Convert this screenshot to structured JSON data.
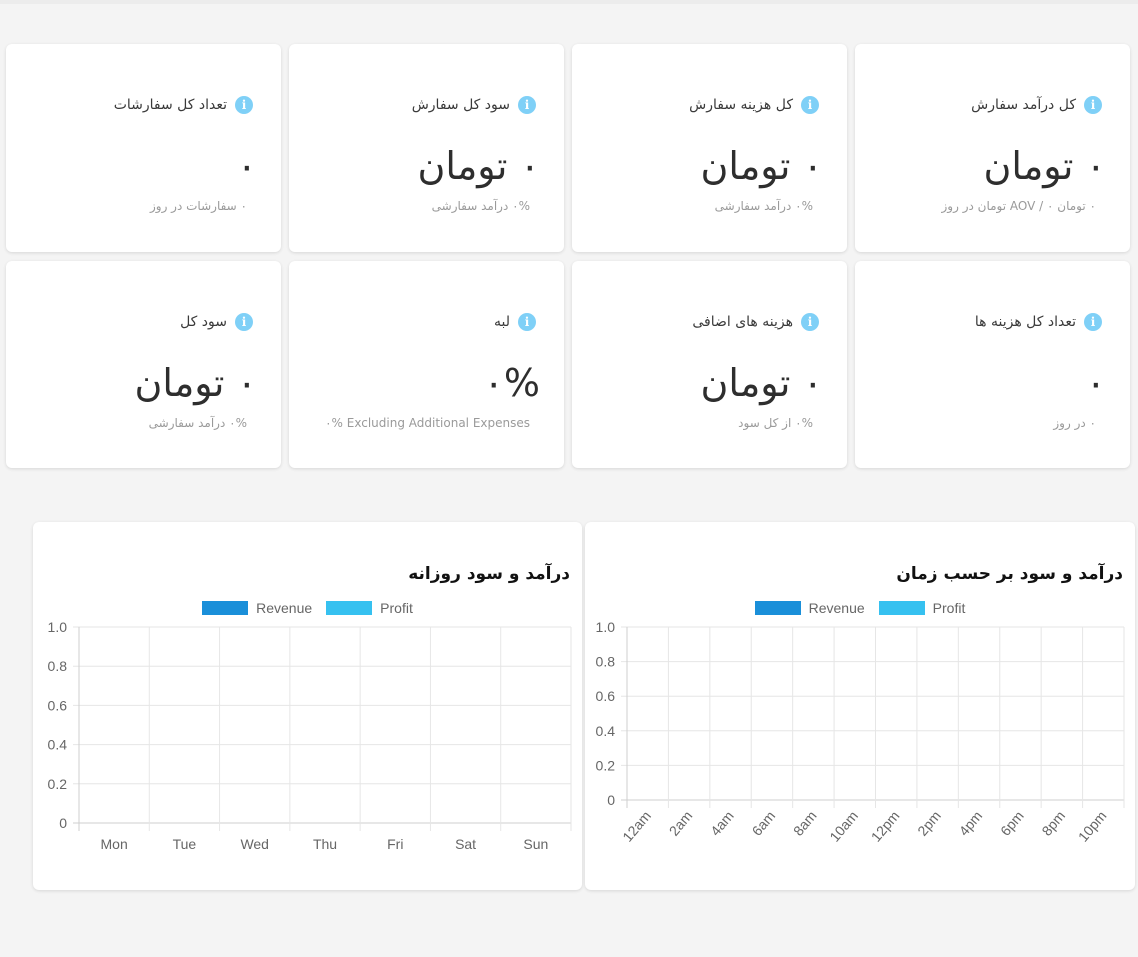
{
  "colors": {
    "revenue": "#1a8fd9",
    "profit": "#36c1f0",
    "info": "#7fd0f7"
  },
  "cards": [
    {
      "title": "کل درآمد سفارش",
      "value": "۰ تومان",
      "sub": "۰ تومان AOV / ۰ تومان در روز"
    },
    {
      "title": "کل هزینه سفارش",
      "value": "۰ تومان",
      "sub": "۰% درآمد سفارشی"
    },
    {
      "title": "سود کل سفارش",
      "value": "۰ تومان",
      "sub": "۰% درآمد سفارشی"
    },
    {
      "title": "تعداد کل سفارشات",
      "value": "۰",
      "sub": "۰ سفارشات در روز"
    },
    {
      "title": "تعداد کل هزینه ها",
      "value": "۰",
      "sub": "۰ در روز"
    },
    {
      "title": "هزینه های اضافی",
      "value": "۰ تومان",
      "sub": "۰% از کل سود"
    },
    {
      "title": "لبه",
      "value": "۰%",
      "sub": "۰% Excluding Additional Expenses"
    },
    {
      "title": "سود کل",
      "value": "۰ تومان",
      "sub": "۰% درآمد سفارشی"
    }
  ],
  "chart_data": [
    {
      "type": "bar",
      "title": "درآمد و سود بر حسب زمان",
      "categories": [
        "12am",
        "2am",
        "4am",
        "6am",
        "8am",
        "10am",
        "12pm",
        "2pm",
        "4pm",
        "6pm",
        "8pm",
        "10pm"
      ],
      "series": [
        {
          "name": "Revenue",
          "values": [
            0,
            0,
            0,
            0,
            0,
            0,
            0,
            0,
            0,
            0,
            0,
            0
          ]
        },
        {
          "name": "Profit",
          "values": [
            0,
            0,
            0,
            0,
            0,
            0,
            0,
            0,
            0,
            0,
            0,
            0
          ]
        }
      ],
      "ylim": [
        0,
        1.0
      ],
      "yticks": [
        "1.0",
        "0.8",
        "0.6",
        "0.4",
        "0.2",
        "0"
      ],
      "legend": "top-center",
      "grid": true
    },
    {
      "type": "bar",
      "title": "درآمد و سود روزانه",
      "categories": [
        "Mon",
        "Tue",
        "Wed",
        "Thu",
        "Fri",
        "Sat",
        "Sun"
      ],
      "series": [
        {
          "name": "Revenue",
          "values": [
            0,
            0,
            0,
            0,
            0,
            0,
            0
          ]
        },
        {
          "name": "Profit",
          "values": [
            0,
            0,
            0,
            0,
            0,
            0,
            0
          ]
        }
      ],
      "ylim": [
        0,
        1.0
      ],
      "yticks": [
        "1.0",
        "0.8",
        "0.6",
        "0.4",
        "0.2",
        "0"
      ],
      "legend": "top-center",
      "grid": true
    }
  ]
}
